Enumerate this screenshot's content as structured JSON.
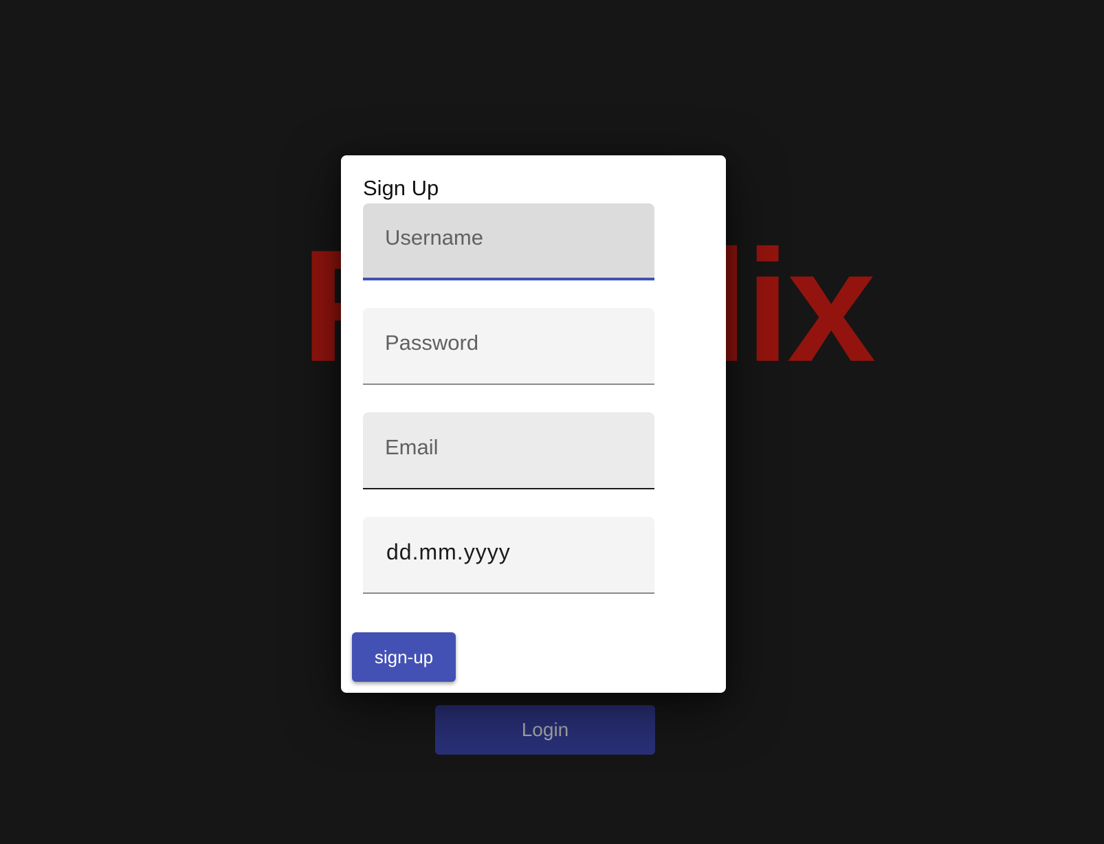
{
  "background": {
    "brand_logo": "Fakeflix",
    "login_button_label": "Login"
  },
  "dialog": {
    "title": "Sign Up",
    "fields": {
      "username": {
        "placeholder": "Username",
        "value": ""
      },
      "password": {
        "placeholder": "Password",
        "value": ""
      },
      "email": {
        "placeholder": "Email",
        "value": ""
      },
      "birthdate": {
        "placeholder": "dd.mm.yyyy"
      }
    },
    "submit_label": "sign-up"
  },
  "colors": {
    "accent": "#4051b5",
    "brand": "#e01f16",
    "page_background": "#1a1a1a"
  }
}
